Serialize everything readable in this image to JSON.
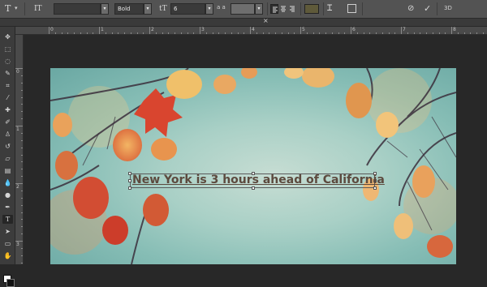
{
  "options_bar": {
    "tool_glyph": "T",
    "orient_glyph": "IT",
    "font_family_value": "",
    "font_style_value": "Bold",
    "size_glyph": "tT",
    "font_size_value": "6",
    "aa_label": "a a",
    "aa_value": "",
    "color_swatch": "#5f5a3a",
    "commit_glyph": "✓",
    "cancel_glyph": "⊘",
    "three_d_label": "3D"
  },
  "document": {
    "close_glyph": "×"
  },
  "rulers": {
    "top": [
      "0",
      "1",
      "2",
      "3",
      "4",
      "5",
      "6",
      "7",
      "8"
    ],
    "left": [
      "0",
      "1",
      "2",
      "3"
    ]
  },
  "canvas": {
    "text": "New York is 3 hours ahead of California"
  },
  "colors": {
    "foreground": "#ffffff",
    "background": "#111111"
  }
}
